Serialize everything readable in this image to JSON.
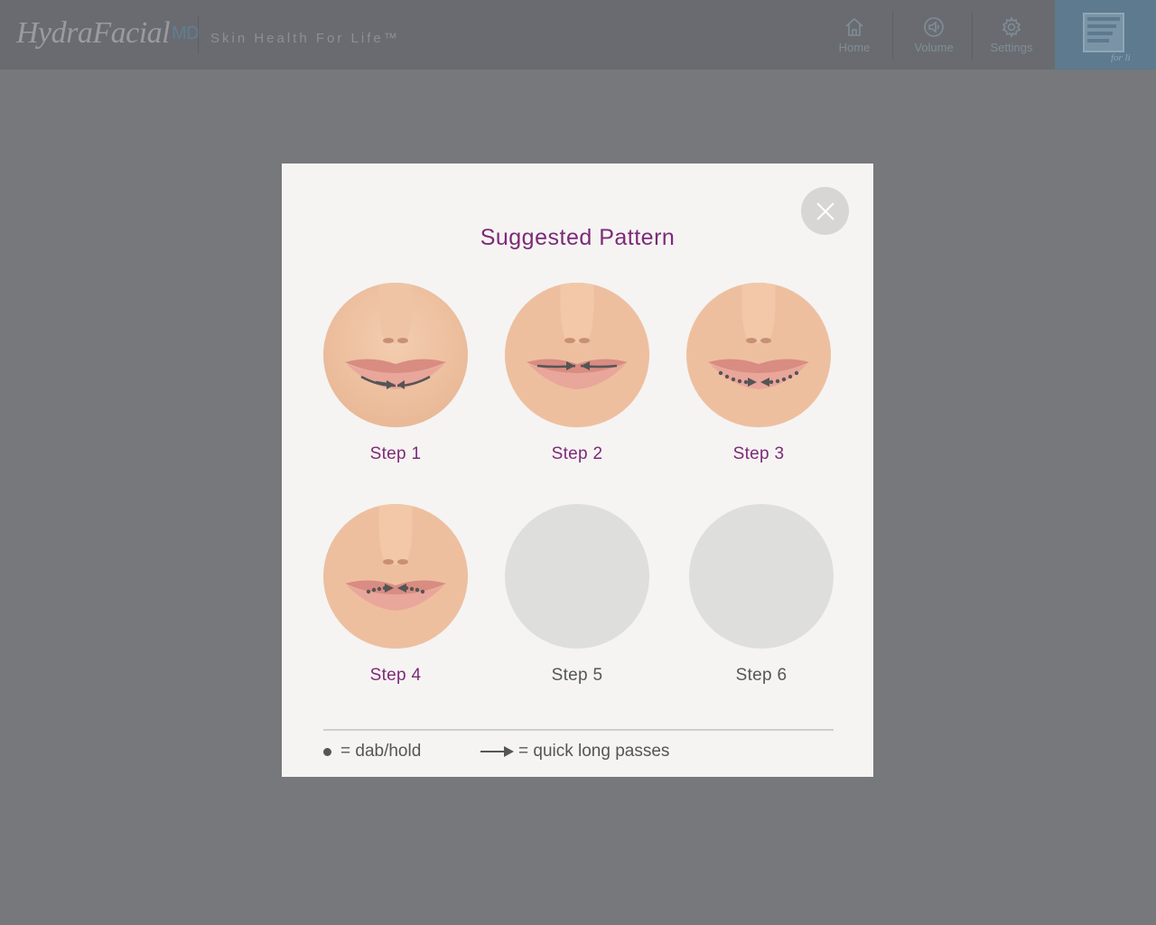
{
  "header": {
    "logo_text": "HydraFacial",
    "logo_suffix": "MD",
    "tagline": "Skin Health For Life™",
    "nav": [
      {
        "label": "Home",
        "icon": "home-icon"
      },
      {
        "label": "Volume",
        "icon": "volume-icon"
      },
      {
        "label": "Settings",
        "icon": "gear-icon"
      }
    ],
    "brand_icon": "edge-for-life-logo"
  },
  "modal": {
    "title": "Suggested Pattern",
    "close_icon": "close-icon",
    "steps": [
      {
        "label": "Step 1",
        "image": "lips-step-1",
        "filled": true
      },
      {
        "label": "Step 2",
        "image": "lips-step-2",
        "filled": true
      },
      {
        "label": "Step 3",
        "image": "lips-step-3",
        "filled": true
      },
      {
        "label": "Step 4",
        "image": "lips-step-4",
        "filled": true
      },
      {
        "label": "Step 5",
        "image": "",
        "filled": false
      },
      {
        "label": "Step 6",
        "image": "",
        "filled": false
      }
    ],
    "legend": {
      "dot_text": "= dab/hold",
      "arrow_text": "= quick long passes"
    }
  },
  "colors": {
    "accent": "#7d2a78",
    "overlay": "#77787c",
    "modal_bg": "#f5f4f2"
  }
}
